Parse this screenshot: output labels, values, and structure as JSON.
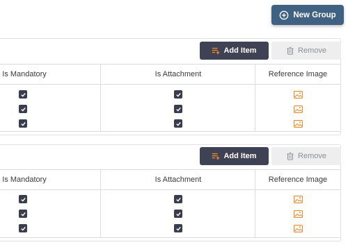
{
  "toolbar": {
    "new_group_label": "New Group"
  },
  "colors": {
    "primary": "#3f6283",
    "dark": "#3f4254",
    "accent_orange": "#e8892c",
    "muted": "#8a8f98"
  },
  "groups": [
    {
      "add_item_label": "Add Item",
      "remove_label": "Remove",
      "columns": {
        "mandatory": "Is Mandatory",
        "attachment": "Is Attachment",
        "reference": "Reference Image"
      },
      "rows": [
        {
          "is_mandatory": true,
          "is_attachment": true,
          "reference_icon": "image-icon"
        },
        {
          "is_mandatory": true,
          "is_attachment": true,
          "reference_icon": "image-icon"
        },
        {
          "is_mandatory": true,
          "is_attachment": true,
          "reference_icon": "image-icon"
        }
      ]
    },
    {
      "add_item_label": "Add Item",
      "remove_label": "Remove",
      "columns": {
        "mandatory": "Is Mandatory",
        "attachment": "Is Attachment",
        "reference": "Reference Image"
      },
      "rows": [
        {
          "is_mandatory": true,
          "is_attachment": true,
          "reference_icon": "image-icon"
        },
        {
          "is_mandatory": true,
          "is_attachment": true,
          "reference_icon": "image-icon"
        },
        {
          "is_mandatory": true,
          "is_attachment": true,
          "reference_icon": "image-icon"
        }
      ]
    }
  ]
}
